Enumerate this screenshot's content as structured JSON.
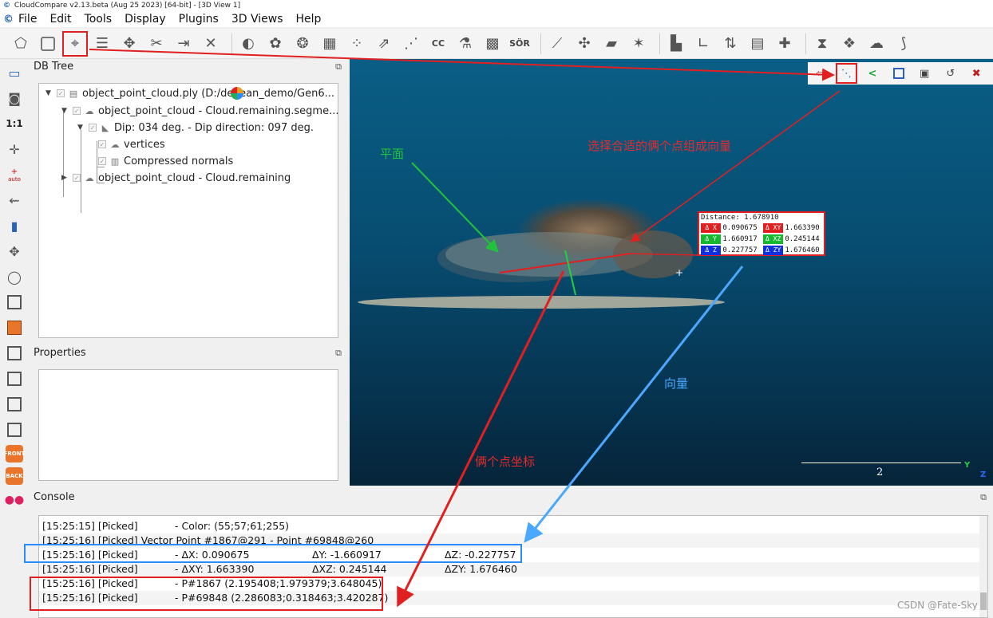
{
  "window": {
    "title": "CloudCompare v2.13.beta (Aug 25 2023) [64-bit] - [3D View 1]"
  },
  "menu": [
    "File",
    "Edit",
    "Tools",
    "Display",
    "Plugins",
    "3D Views",
    "Help"
  ],
  "toolbar": {
    "sor_label": "SÖR",
    "cc_label": "CC"
  },
  "left_tools": {
    "ratio_label": "1:1",
    "auto_label": "auto",
    "front_label": "FRONT",
    "back_label": "BACK"
  },
  "db_tree": {
    "title": "DB Tree",
    "items": [
      "object_point_cloud.ply (D:/de  lean_demo/Gen6...",
      "object_point_cloud - Cloud.remaining.segme...",
      "Dip: 034 deg. - Dip direction: 097 deg.",
      "vertices",
      "Compressed normals",
      "object_point_cloud - Cloud.remaining"
    ]
  },
  "properties": {
    "title": "Properties"
  },
  "measure": {
    "distance": "Distance: 1.678910",
    "rows": [
      {
        "l1": "Δ X",
        "v1": "0.090675",
        "l2": "Δ XY",
        "v2": "1.663390"
      },
      {
        "l1": "Δ Y",
        "v1": "1.660917",
        "l2": "Δ XZ",
        "v2": "0.245144"
      },
      {
        "l1": "Δ Z",
        "v1": "0.227757",
        "l2": "Δ ZY",
        "v2": "1.676460"
      }
    ]
  },
  "scale": {
    "value": "2",
    "axis_y": "Y",
    "axis_z": "Z"
  },
  "annotations": {
    "plane": "平面",
    "select": "选择合适的俩个点组成向量",
    "vector": "向量",
    "coords": "俩个点坐标"
  },
  "console": {
    "title": "Console",
    "lines": [
      {
        "ts": "[15:25:15] [Picked]",
        "msg": "      - Color: (55;57;61;255)",
        "c2": "",
        "c3": ""
      },
      {
        "ts": "[15:25:16] [Picked]",
        "msg": "Vector Point #1867@291 - Point #69848@260",
        "c2": "",
        "c3": ""
      },
      {
        "ts": "[15:25:16] [Picked]",
        "msg": "      - ΔX: 0.090675",
        "c2": "ΔY: -1.660917",
        "c3": "ΔZ: -0.227757"
      },
      {
        "ts": "[15:25:16] [Picked]",
        "msg": "      - ΔXY: 1.663390",
        "c2": "ΔXZ: 0.245144",
        "c3": "ΔZY: 1.676460"
      },
      {
        "ts": "[15:25:16] [Picked]",
        "msg": "      - P#1867 (2.195408;1.979379;3.648045)",
        "c2": "",
        "c3": ""
      },
      {
        "ts": "[15:25:16] [Picked]",
        "msg": "      - P#69848 (2.286083;0.318463;3.420287)",
        "c2": "",
        "c3": ""
      }
    ]
  },
  "watermark": "CSDN @Fate-Sky",
  "colors": {
    "annotation_red": "#e62a2a",
    "annotation_green": "#1fc43a",
    "annotation_blue": "#4aa8ff"
  }
}
